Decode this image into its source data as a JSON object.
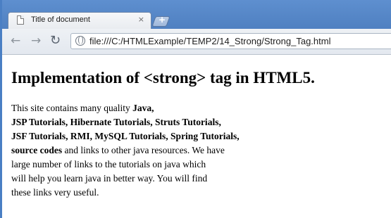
{
  "browser": {
    "tab_title": "Title of document",
    "tab_close": "×",
    "new_tab": "+",
    "back": "←",
    "forward": "→",
    "reload": "↻",
    "url": "file:///C:/HTMLExample/TEMP2/14_Strong/Strong_Tag.html"
  },
  "page": {
    "heading": "Implementation of <strong> tag in HTML5.",
    "lines": [
      {
        "a": "This site contains many quality ",
        "b": "Java,",
        "c": ""
      },
      {
        "a": "",
        "b": "JSP Tutorials, Hibernate Tutorials, Struts Tutorials,",
        "c": ""
      },
      {
        "a": "",
        "b": "JSF Tutorials, RMI, MySQL Tutorials, Spring Tutorials,",
        "c": ""
      },
      {
        "a": "",
        "b": "source codes",
        "c": " and links to other java resources. We have"
      },
      {
        "a": "large number of links to the tutorials on java which",
        "b": "",
        "c": ""
      },
      {
        "a": "will help you learn java in better way. You will find",
        "b": "",
        "c": ""
      },
      {
        "a": "these links very useful.",
        "b": "",
        "c": ""
      }
    ]
  }
}
